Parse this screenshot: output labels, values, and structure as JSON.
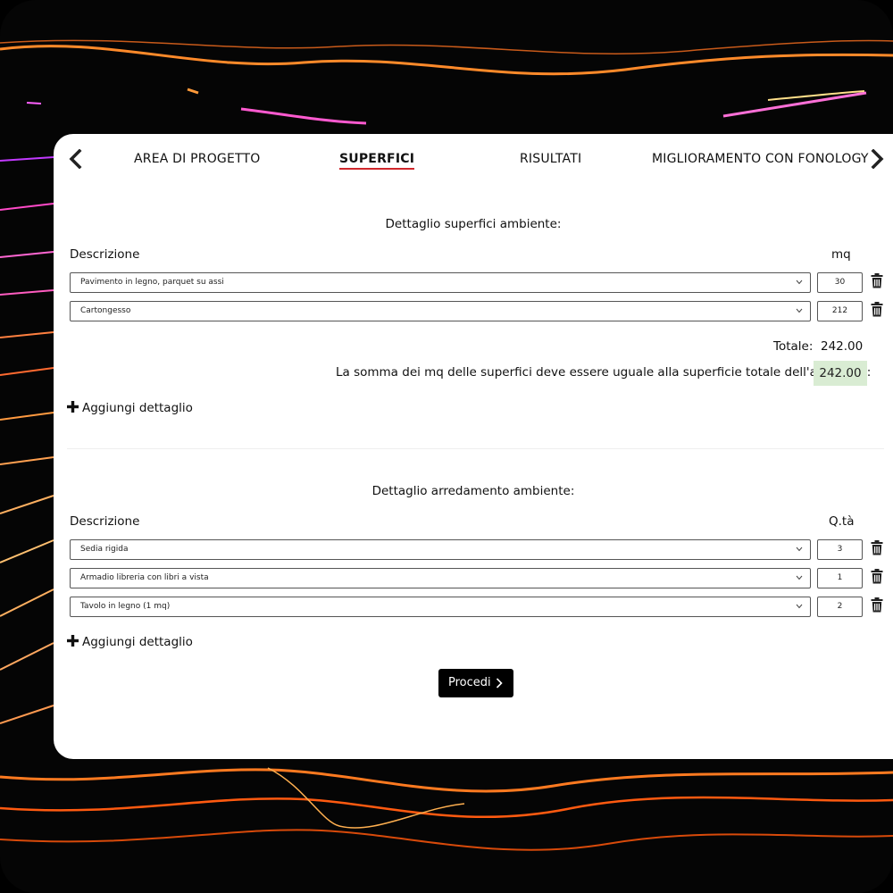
{
  "colors": {
    "accent_underline": "#d0262b",
    "sum_ok_background": "#d9ecd3",
    "button_background": "#000000"
  },
  "nav": {
    "prev_icon": "chevron-left-icon",
    "next_icon": "chevron-right-icon",
    "tabs": [
      {
        "label": "AREA DI PROGETTO",
        "active": false
      },
      {
        "label": "SUPERFICI",
        "active": true
      },
      {
        "label": "RISULTATI",
        "active": false
      },
      {
        "label": "MIGLIORAMENTO CON FONOLOGY",
        "active": false
      }
    ]
  },
  "surfaces": {
    "title": "Dettaglio superfici ambiente:",
    "col_description": "Descrizione",
    "col_quantity": "mq",
    "rows": [
      {
        "description": "Pavimento in legno, parquet su assi",
        "value": "30"
      },
      {
        "description": "Cartongesso",
        "value": "212"
      }
    ],
    "total_label": "Totale:",
    "total_value": "242.00",
    "sum_note": "La somma dei mq delle superfici deve essere uguale alla superficie totale dell'ambiente:",
    "sum_value": "242.00",
    "add_label": "Aggiungi dettaglio"
  },
  "furniture": {
    "title": "Dettaglio arredamento ambiente:",
    "col_description": "Descrizione",
    "col_quantity": "Q.tà",
    "rows": [
      {
        "description": "Sedia rigida",
        "value": "3"
      },
      {
        "description": "Armadio libreria con libri a vista",
        "value": "1"
      },
      {
        "description": "Tavolo in legno (1 mq)",
        "value": "2"
      }
    ],
    "add_label": "Aggiungi dettaglio"
  },
  "proceed_label": "Procedi"
}
